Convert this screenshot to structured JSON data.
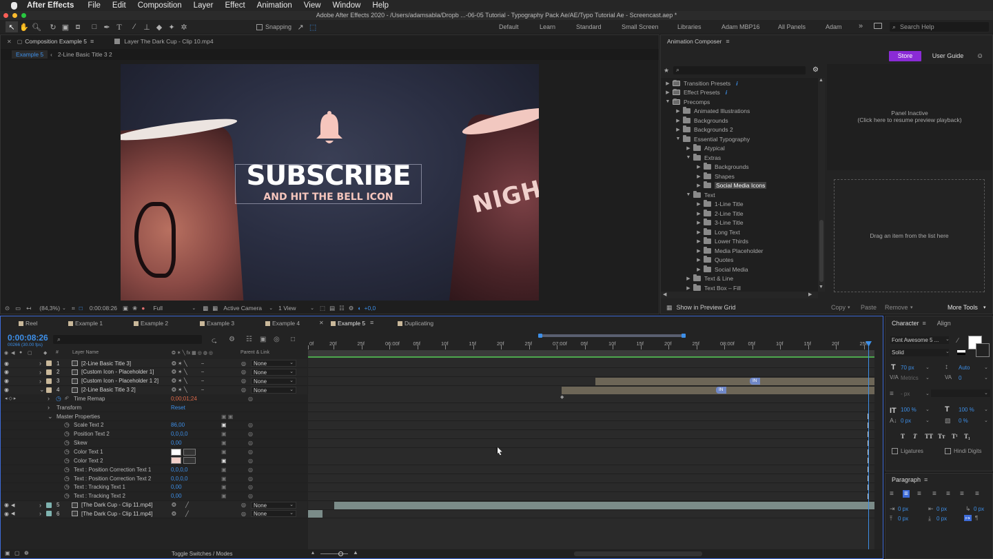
{
  "menubar": {
    "apple": "",
    "app_name": "After Effects",
    "items": [
      "File",
      "Edit",
      "Composition",
      "Layer",
      "Effect",
      "Animation",
      "View",
      "Window",
      "Help"
    ]
  },
  "titlebar": {
    "title": "Adobe After Effects 2020 - /Users/adamsabla/Dropb ...-06-05 Tutorial - Typography Pack Ae/AE/Typo Tutorial Ae - Screencast.aep *"
  },
  "toolbar": {
    "snapping_label": "Snapping",
    "workspaces": [
      "Default",
      "Learn",
      "Standard",
      "Small Screen",
      "Libraries",
      "Adam MBP16",
      "All Panels",
      "Adam"
    ],
    "search_placeholder": "Search Help"
  },
  "comp_panel": {
    "tab_label": "Composition Example 5",
    "layer_tab_label": "Layer The Dark Cup - Clip 10.mp4",
    "breadcrumbs": [
      "Example 5",
      "2-Line Basic Title 3 2"
    ],
    "viewer_title_line1": "SUBSCRIBE",
    "viewer_title_line2": "AND HIT THE BELL ICON",
    "cup_text": "NIGHT",
    "footer": {
      "zoom": "(84,3%)",
      "timecode": "0:00:08:26",
      "resolution": "Full",
      "camera": "Active Camera",
      "view": "1 View",
      "exposure": "+0,0"
    }
  },
  "composer": {
    "title": "Animation Composer",
    "store_label": "Store",
    "guide_label": "User Guide",
    "preview_line1": "Panel Inactive",
    "preview_line2": "(Click here to resume preview playback)",
    "drop_hint": "Drag an item from the list here",
    "show_grid_label": "Show in Preview Grid",
    "copy_label": "Copy",
    "paste_label": "Paste",
    "remove_label": "Remove",
    "more_tools_label": "More Tools",
    "tree": [
      {
        "label": "Transition Presets",
        "depth": 0,
        "open": false,
        "info": "i"
      },
      {
        "label": "Effect Presets",
        "depth": 0,
        "open": false,
        "info": "i"
      },
      {
        "label": "Precomps",
        "depth": 0,
        "open": true
      },
      {
        "label": "Animated Illustrations",
        "depth": 1,
        "open": false
      },
      {
        "label": "Backgrounds",
        "depth": 1,
        "open": false
      },
      {
        "label": "Backgrounds 2",
        "depth": 1,
        "open": false
      },
      {
        "label": "Essential Typography",
        "depth": 1,
        "open": true
      },
      {
        "label": "Atypical",
        "depth": 2,
        "open": false
      },
      {
        "label": "Extras",
        "depth": 2,
        "open": true
      },
      {
        "label": "Backgrounds",
        "depth": 3,
        "open": false
      },
      {
        "label": "Shapes",
        "depth": 3,
        "open": false
      },
      {
        "label": "Social Media Icons",
        "depth": 3,
        "open": false,
        "selected": true
      },
      {
        "label": "Text",
        "depth": 2,
        "open": true
      },
      {
        "label": "1-Line Title",
        "depth": 3,
        "open": false
      },
      {
        "label": "2-Line Title",
        "depth": 3,
        "open": false
      },
      {
        "label": "3-Line Title",
        "depth": 3,
        "open": false
      },
      {
        "label": "Long Text",
        "depth": 3,
        "open": false
      },
      {
        "label": "Lower Thirds",
        "depth": 3,
        "open": false
      },
      {
        "label": "Media Placeholder",
        "depth": 3,
        "open": false
      },
      {
        "label": "Quotes",
        "depth": 3,
        "open": false
      },
      {
        "label": "Social Media",
        "depth": 3,
        "open": false
      },
      {
        "label": "Text & Line",
        "depth": 2,
        "open": false
      },
      {
        "label": "Text Box – Fill",
        "depth": 2,
        "open": false
      }
    ]
  },
  "timeline": {
    "tabs": [
      "Reel",
      "Example 1",
      "Example 2",
      "Example 3",
      "Example 4",
      "Example 5",
      "Duplicating"
    ],
    "active_tab": "Example 5",
    "timecode": "0:00:08:26",
    "frame_info": "00266 (30.00 fps)",
    "col_hash": "#",
    "col_layer_name": "Layer Name",
    "col_parent": "Parent & Link",
    "ruler": [
      "0f",
      "20f",
      "25f",
      "06:00f",
      "05f",
      "10f",
      "15f",
      "20f",
      "25f",
      "07:00f",
      "05f",
      "10f",
      "15f",
      "20f",
      "25f",
      "08:00f",
      "05f",
      "10f",
      "15f",
      "20f",
      "25f"
    ],
    "layers": [
      {
        "num": "1",
        "name": "[2-Line Basic Title 3]",
        "parent": "None",
        "chip": "#c9b89a"
      },
      {
        "num": "2",
        "name": "[Custom Icon - Placeholder 1]",
        "parent": "None",
        "chip": "#c9b89a"
      },
      {
        "num": "3",
        "name": "[Custom Icon - Placeholder 1 2]",
        "parent": "None",
        "chip": "#c9b89a"
      },
      {
        "num": "4",
        "name": "[2-Line Basic Title 3 2]",
        "parent": "None",
        "chip": "#c9b89a"
      }
    ],
    "props": [
      {
        "name": "Time Remap",
        "value": "0;00;01;24",
        "value_color": "#e06a4a",
        "indent": 1
      },
      {
        "name": "Transform",
        "value": "Reset",
        "indent": 0
      },
      {
        "name": "Master Properties",
        "value": "",
        "indent": 0
      },
      {
        "name": "Scale Text 2",
        "value": "86,00",
        "indent": 2
      },
      {
        "name": "Position Text 2",
        "value": "0,0,0,0",
        "indent": 2
      },
      {
        "name": "Skew",
        "value": "0,00",
        "indent": 2
      },
      {
        "name": "Color Text 1",
        "value": "",
        "indent": 2,
        "color": "#ffffff"
      },
      {
        "name": "Color Text 2",
        "value": "",
        "indent": 2,
        "color": "#f3d0c8"
      },
      {
        "name": "Text : Position Correction Text 1",
        "value": "0,0,0,0",
        "indent": 2
      },
      {
        "name": "Text : Position Correction Text 2",
        "value": "0,0,0,0",
        "indent": 2
      },
      {
        "name": "Text : Tracking Text 1",
        "value": "0,00",
        "indent": 2
      },
      {
        "name": "Text : Tracking Text 2",
        "value": "0,00",
        "indent": 2
      }
    ],
    "footage": [
      {
        "num": "5",
        "name": "[The Dark Cup - Clip 11.mp4]",
        "parent": "None",
        "chip": "#7fb3b0"
      },
      {
        "num": "6",
        "name": "[The Dark Cup - Clip 11.mp4]",
        "parent": "None",
        "chip": "#7fb3b0"
      }
    ],
    "marker_label": "IN",
    "toggle_label": "Toggle Switches / Modes"
  },
  "character": {
    "tab_label": "Character",
    "align_tab": "Align",
    "font": "Font Awesome 5 ...",
    "style": "Solid",
    "size": "70 px",
    "leading": "Auto",
    "kerning": "Metrics",
    "tracking": "0",
    "stroke": "- px",
    "vscale": "100 %",
    "hscale": "100 %",
    "baseline": "0 px",
    "tsume": "0 %",
    "ligatures_label": "Ligatures",
    "hindi_label": "Hindi Digits",
    "paragraph_label": "Paragraph",
    "indent1": "0 px",
    "indent2": "0 px",
    "indent3": "0 px",
    "space1": "0 px",
    "space2": "0 px"
  }
}
